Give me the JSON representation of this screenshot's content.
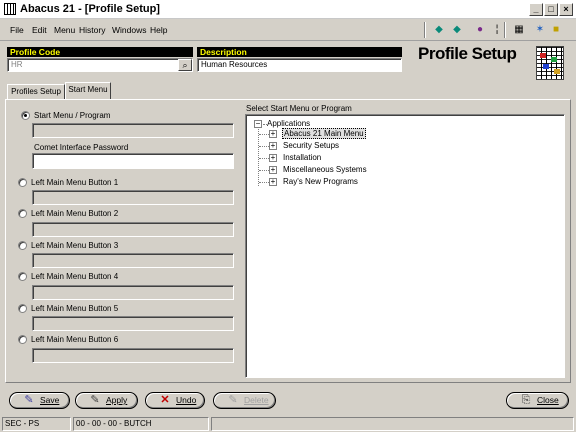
{
  "window": {
    "title": "Abacus 21 - [Profile Setup]",
    "minimize": "_",
    "maximize": "□",
    "close": "×"
  },
  "menu": [
    "File",
    "Edit",
    "Menu",
    "History",
    "Windows",
    "Help"
  ],
  "header": {
    "profile_code_label": "Profile Code",
    "profile_code_value": "HR",
    "description_label": "Description",
    "description_value": "Human Resources",
    "page_title": "Profile Setup"
  },
  "tabs": [
    {
      "label": "Profiles Setup"
    },
    {
      "label": "Start Menu"
    }
  ],
  "start_menu": {
    "options": [
      {
        "label": "Start Menu / Program",
        "selected": true
      },
      {
        "label": "Left Main Menu Button 1",
        "selected": false
      },
      {
        "label": "Left Main Menu Button 2",
        "selected": false
      },
      {
        "label": "Left Main Menu Button 3",
        "selected": false
      },
      {
        "label": "Left Main Menu Button 4",
        "selected": false
      },
      {
        "label": "Left Main Menu Button 5",
        "selected": false
      },
      {
        "label": "Left Main Menu Button 6",
        "selected": false
      }
    ],
    "password_label": "Comet Interface Password",
    "password_value": ""
  },
  "tree": {
    "label": "Select Start Menu or Program",
    "root": "Applications",
    "items": [
      {
        "label": "Abacus 21 Main Menu",
        "selected": true
      },
      {
        "label": "Security Setups",
        "selected": false
      },
      {
        "label": "Installation",
        "selected": false
      },
      {
        "label": "Miscellaneous Systems",
        "selected": false
      },
      {
        "label": "Ray's New Programs",
        "selected": false
      }
    ],
    "expand_sign": "+",
    "collapse_sign": "−"
  },
  "buttons": {
    "save": "Save",
    "apply": "Apply",
    "undo": "Undo",
    "delete": "Delete",
    "close": "Close"
  },
  "status": {
    "left": "SEC - PS",
    "middle": "00 - 00 - 00 - BUTCH"
  }
}
